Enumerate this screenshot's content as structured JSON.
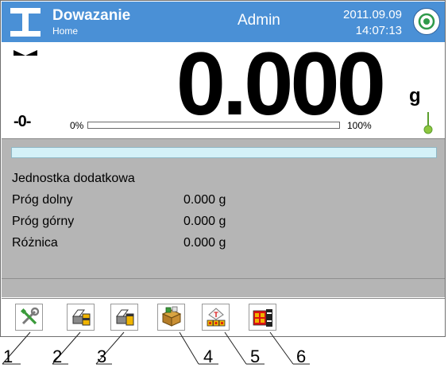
{
  "header": {
    "title": "Dowazanie",
    "subtitle": "Home",
    "user": "Admin",
    "date": "2011.09.09",
    "time": "14:07:13",
    "app_icon": "scale-icon",
    "power_icon": "power-icon",
    "background_color": "#4a90d6"
  },
  "display": {
    "stable_icon": "stable-indicator-icon",
    "zero_indicator": "-0-",
    "weight": "0.000",
    "unit": "g",
    "bar_min_label": "0%",
    "bar_max_label": "100%",
    "bar_fill_percent": 0,
    "level_icon": "level-indicator-icon"
  },
  "info": {
    "heading": "Jednostka dodatkowa",
    "rows": [
      {
        "label": "Próg dolny",
        "value": "0.000 g"
      },
      {
        "label": "Próg górny",
        "value": "0.000 g"
      },
      {
        "label": "Różnica",
        "value": "0.000 g"
      }
    ],
    "panel_color": "#b5b5b5"
  },
  "toolbar": {
    "buttons": [
      {
        "icon": "tools-icon"
      },
      {
        "icon": "printer-icon"
      },
      {
        "icon": "printer-header-icon"
      },
      {
        "icon": "database-box-icon"
      },
      {
        "icon": "tare-icon"
      },
      {
        "icon": "thresholds-icon"
      }
    ]
  },
  "callouts": [
    "1",
    "2",
    "3",
    "4",
    "5",
    "6"
  ]
}
